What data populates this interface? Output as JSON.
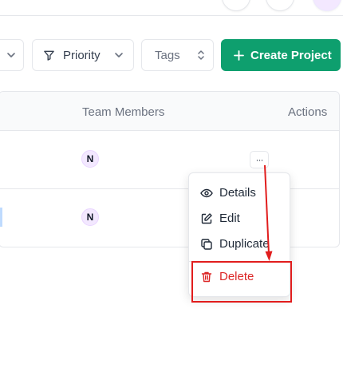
{
  "toolbar": {
    "priority_label": "Priority",
    "tags_label": "Tags",
    "create_label": "Create Project"
  },
  "table": {
    "col_team": "Team Members",
    "col_actions": "Actions",
    "rows": [
      {
        "member_initial": "N",
        "actions_glyph": "···"
      },
      {
        "member_initial": "N"
      }
    ]
  },
  "menu": {
    "items": [
      {
        "label": "Details",
        "icon": "eye-icon"
      },
      {
        "label": "Edit",
        "icon": "pencil-square-icon"
      },
      {
        "label": "Duplicate",
        "icon": "copy-icon"
      },
      {
        "label": "Delete",
        "icon": "trash-icon"
      }
    ]
  },
  "colors": {
    "primary": "#0e9f6e",
    "danger": "#dc2626",
    "annotation": "#e11d1d"
  }
}
